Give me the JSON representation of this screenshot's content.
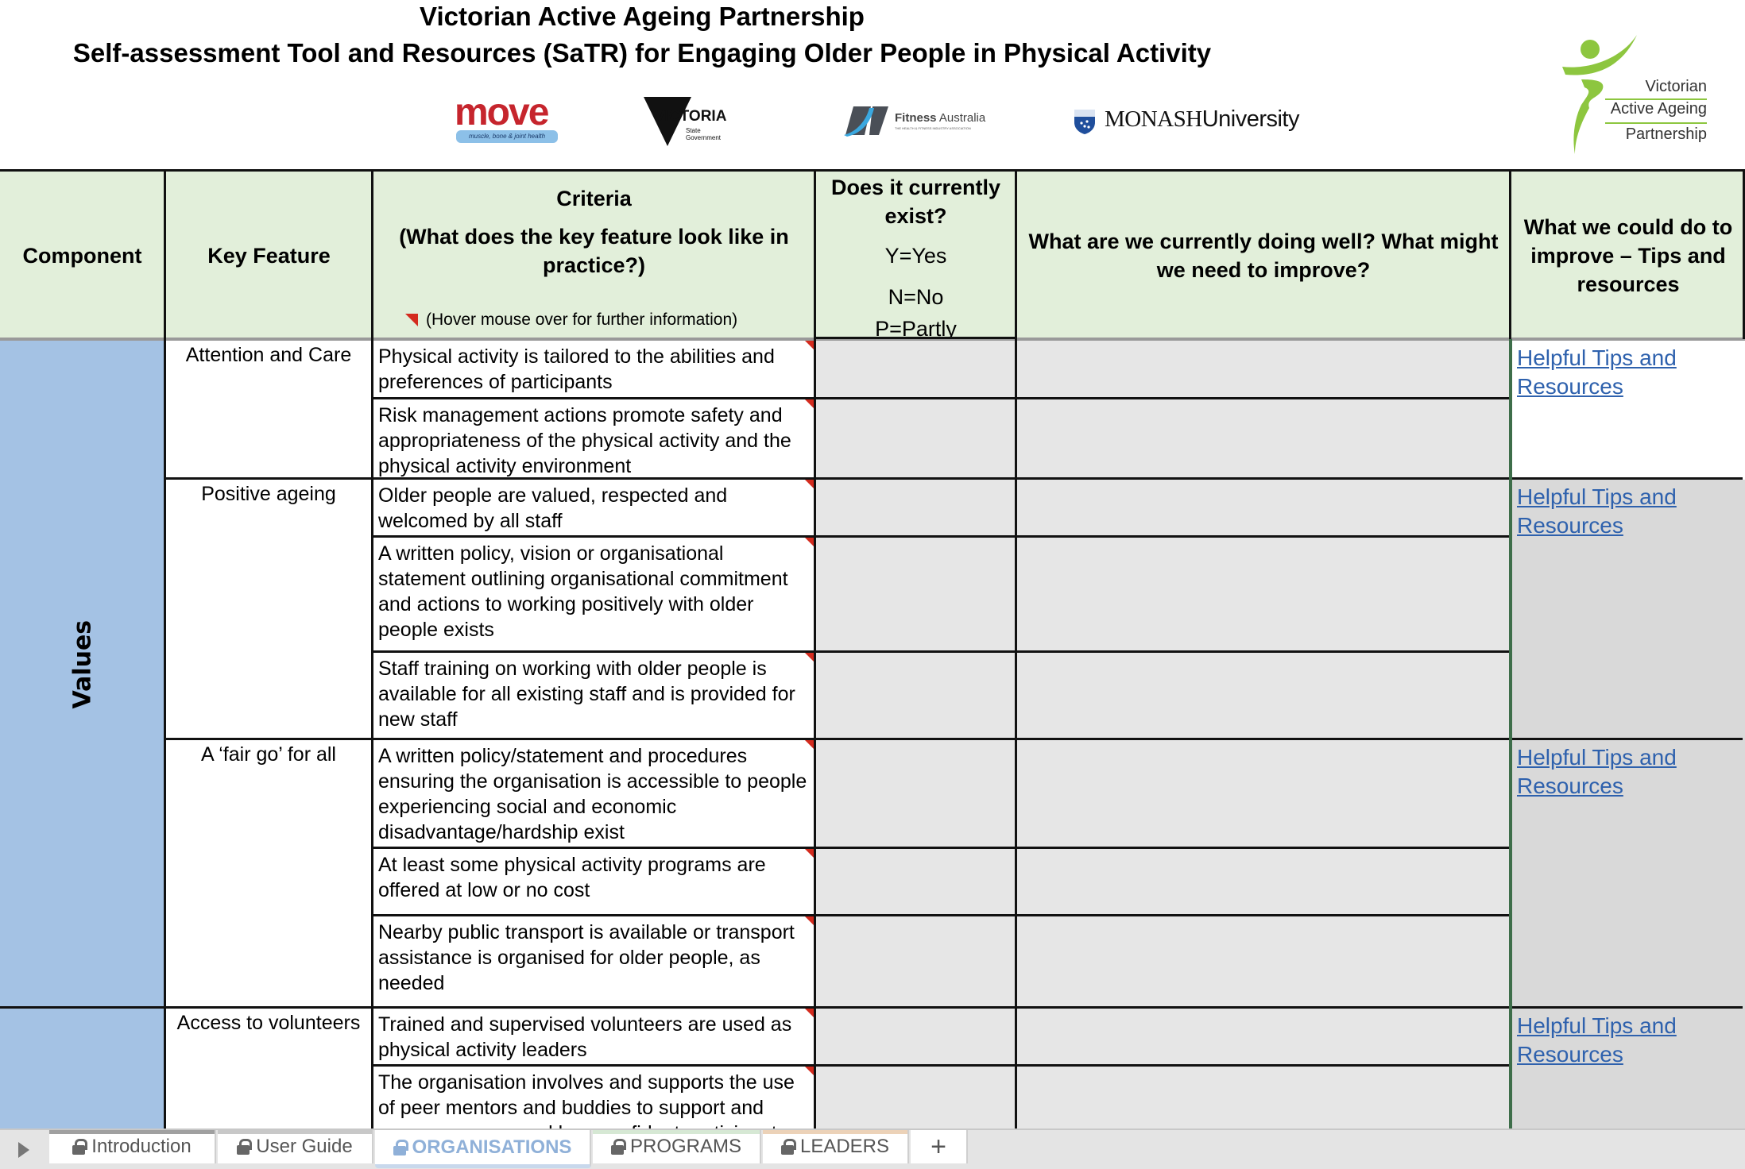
{
  "header": {
    "title_line1": "Victorian Active Ageing Partnership",
    "title_line2": "Self-assessment Tool and Resources (SaTR) for Engaging Older People in Physical Activity"
  },
  "logos": {
    "move": {
      "word": "move",
      "tagline": "muscle, bone & joint health"
    },
    "victoria": {
      "word": "VICTORIA",
      "sub1": "State",
      "sub2": "Government"
    },
    "fitness": {
      "word_bold": "Fitness",
      "word": " Australia",
      "sub": "THE HEALTH & FITNESS INDUSTRY ASSOCIATION"
    },
    "monash": {
      "word_bold": "MONASH",
      "word": "University"
    },
    "vaap": {
      "line1": "Victorian",
      "line2": "Active Ageing",
      "line3": "Partnership",
      "color": "#8dc63f"
    }
  },
  "columns": {
    "component": "Component",
    "key_feature": "Key Feature",
    "criteria_title": "Criteria",
    "criteria_sub": "(What does the key feature look like in practice?)",
    "criteria_hint": "(Hover mouse over for further information)",
    "exist_title": "Does it currently exist?",
    "exist_y": "Y=Yes",
    "exist_n": "N=No",
    "exist_p": "P=Partly",
    "doing_well": "What are we currently doing well? What might we need to improve?",
    "tips": "What we could do to improve – Tips and resources"
  },
  "components": [
    {
      "name": "Values"
    }
  ],
  "key_features": [
    {
      "name": "Attention and Care",
      "tips_link": "Helpful Tips and Resources"
    },
    {
      "name": "Positive ageing",
      "tips_link": "Helpful Tips and Resources"
    },
    {
      "name": "A ‘fair go’ for all",
      "tips_link": "Helpful Tips and Resources"
    },
    {
      "name": "Access to volunteers",
      "tips_link": "Helpful Tips and Resources"
    }
  ],
  "criteria": [
    {
      "text": "Physical activity is tailored to the abilities   and preferences of participants",
      "exists": "",
      "notes": ""
    },
    {
      "text": "Risk management actions promote safety and appropriateness of the physical activity and the physical activity environment",
      "exists": "",
      "notes": ""
    },
    {
      "text": "Older people are valued, respected and welcomed by all staff",
      "exists": "",
      "notes": ""
    },
    {
      "text": "A written policy, vision or organisational statement outlining organisational commitment and actions to working positively with older people exists",
      "exists": "",
      "notes": ""
    },
    {
      "text": "Staff training on working with older people is available for all existing staff and is provided for new staff",
      "exists": "",
      "notes": ""
    },
    {
      "text": "A written policy/statement and procedures ensuring the organisation is accessible to people experiencing social and economic disadvantage/hardship exist",
      "exists": "",
      "notes": ""
    },
    {
      "text": "At least some physical activity programs are offered at low or no cost",
      "exists": "",
      "notes": ""
    },
    {
      "text": "Nearby public transport is available or transport assistance is organised for older people, as needed",
      "exists": "",
      "notes": ""
    },
    {
      "text": "Trained and supervised volunteers are used as physical activity leaders",
      "exists": "",
      "notes": ""
    },
    {
      "text": "The organisation involves and supports the use of peer mentors and buddies to support and encourage new and less confident participants",
      "exists": "",
      "notes": ""
    }
  ],
  "sheet_tabs": [
    {
      "label": "Introduction",
      "locked": true,
      "active": false,
      "color": "#a0a0a0"
    },
    {
      "label": "User Guide",
      "locked": true,
      "active": false,
      "color": "#c8c8c8"
    },
    {
      "label": "ORGANISATIONS",
      "locked": true,
      "active": true,
      "color": "#c8d8ec"
    },
    {
      "label": "PROGRAMS",
      "locked": true,
      "active": false,
      "color": "#d6e8d4"
    },
    {
      "label": "LEADERS",
      "locked": true,
      "active": false,
      "color": "#ecd2b8"
    }
  ],
  "tabbar": {
    "add_label": "+",
    "scroll_icon": "play-icon"
  },
  "colors": {
    "header_fill": "#e2efda",
    "component_fill": "#a4c2e4",
    "input_fill": "#e6e6e6",
    "tips_fill": "#d9d9d9",
    "link": "#2e61ad",
    "comment_marker": "#d42b1e"
  }
}
